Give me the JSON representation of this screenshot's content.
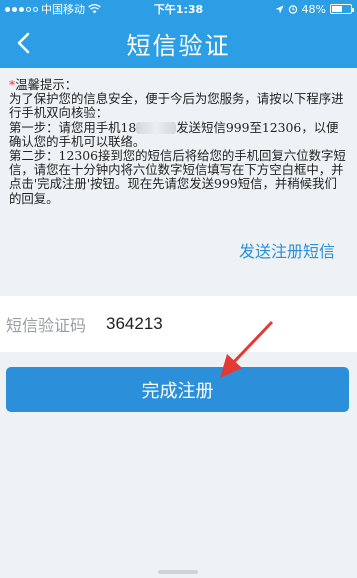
{
  "status_bar": {
    "carrier": "中国移动",
    "time": "下午1:38",
    "battery": "48%",
    "battery_level": 0.48,
    "icons": [
      "signal-dots",
      "wifi-icon",
      "location-icon",
      "alarm-icon",
      "battery-icon"
    ]
  },
  "nav": {
    "title": "短信验证",
    "back_icon": "chevron-left-icon"
  },
  "notice": {
    "heading": "温馨提示：",
    "intro": "为了保护您的信息安全，便于今后为您服务，请按以下程序进行手机双向核验：",
    "step1_prefix": "第一步：请您用手机18",
    "step1_suffix": "发送短信999至12306，以便确认您的手机可以联络。",
    "step2": "第二步：12306接到您的短信后将给您的手机回复六位数字短信，请您在十分钟内将六位数字短信填写在下方空白框中，并点击'完成注册'按钮。现在先请您发送999短信，并稍候我们的回复。"
  },
  "send_link": "发送注册短信",
  "code_field": {
    "label": "短信验证码",
    "value": "364213"
  },
  "submit_label": "完成注册",
  "colors": {
    "primary": "#2b9ee5",
    "button": "#2b8fd9",
    "required_star": "#e53935",
    "arrow": "#e53935"
  }
}
